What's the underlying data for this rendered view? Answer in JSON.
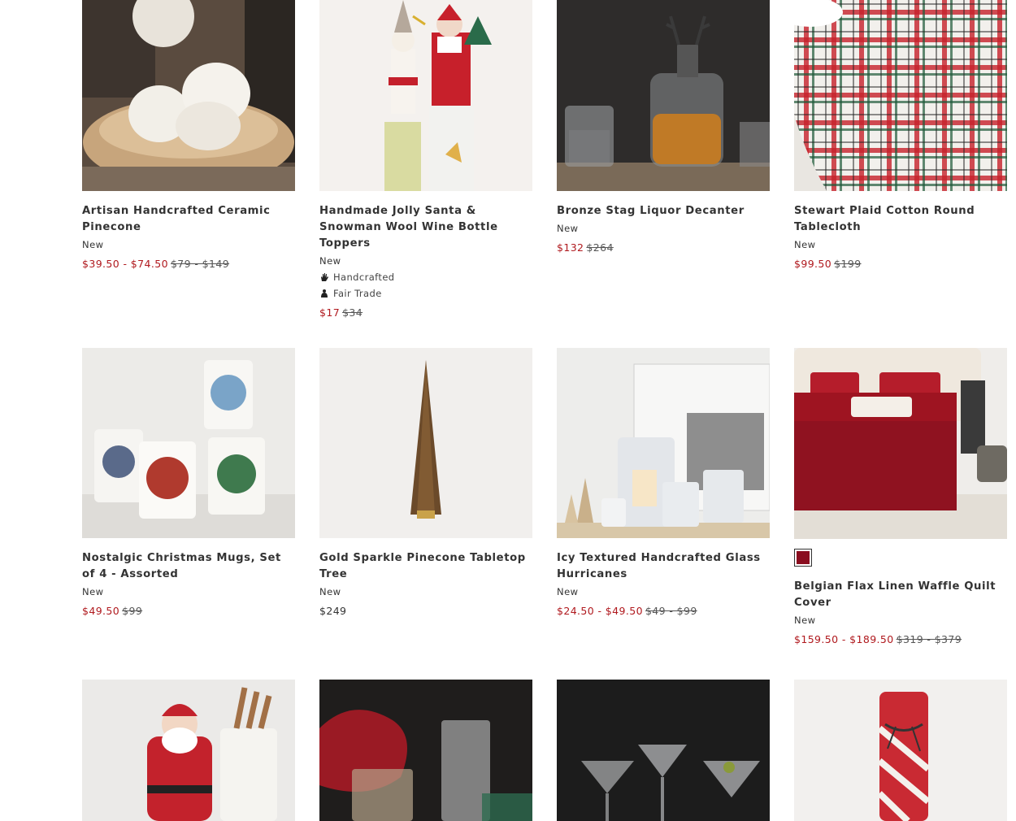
{
  "products": [
    {
      "name": "Artisan Handcrafted Ceramic Pinecone",
      "badge": "New",
      "sale": "$39.50 - $74.50",
      "orig": "$79 - $149"
    },
    {
      "name": "Handmade Jolly Santa & Snowman Wool Wine Bottle Toppers",
      "badge": "New",
      "tag1": "Handcrafted",
      "tag2": "Fair Trade",
      "sale": "$17",
      "orig": "$34"
    },
    {
      "name": "Bronze Stag Liquor Decanter",
      "badge": "New",
      "sale": "$132",
      "orig": "$264"
    },
    {
      "name": "Stewart Plaid Cotton Round Tablecloth",
      "badge": "New",
      "sale": "$99.50",
      "orig": "$199"
    },
    {
      "name": "Nostalgic Christmas Mugs, Set of 4 - Assorted",
      "badge": "New",
      "sale": "$49.50",
      "orig": "$99"
    },
    {
      "name": "Gold Sparkle Pinecone Tabletop Tree",
      "badge": "New",
      "price": "$249"
    },
    {
      "name": "Icy Textured Handcrafted Glass Hurricanes",
      "badge": "New",
      "sale": "$24.50 - $49.50",
      "orig": "$49 - $99"
    },
    {
      "name": "Belgian Flax Linen Waffle Quilt Cover",
      "badge": "New",
      "sale": "$159.50 - $189.50",
      "orig": "$319 - $379",
      "swatch_color": "#8a0d1f"
    }
  ],
  "colors": {
    "sale": "#b0191e"
  }
}
